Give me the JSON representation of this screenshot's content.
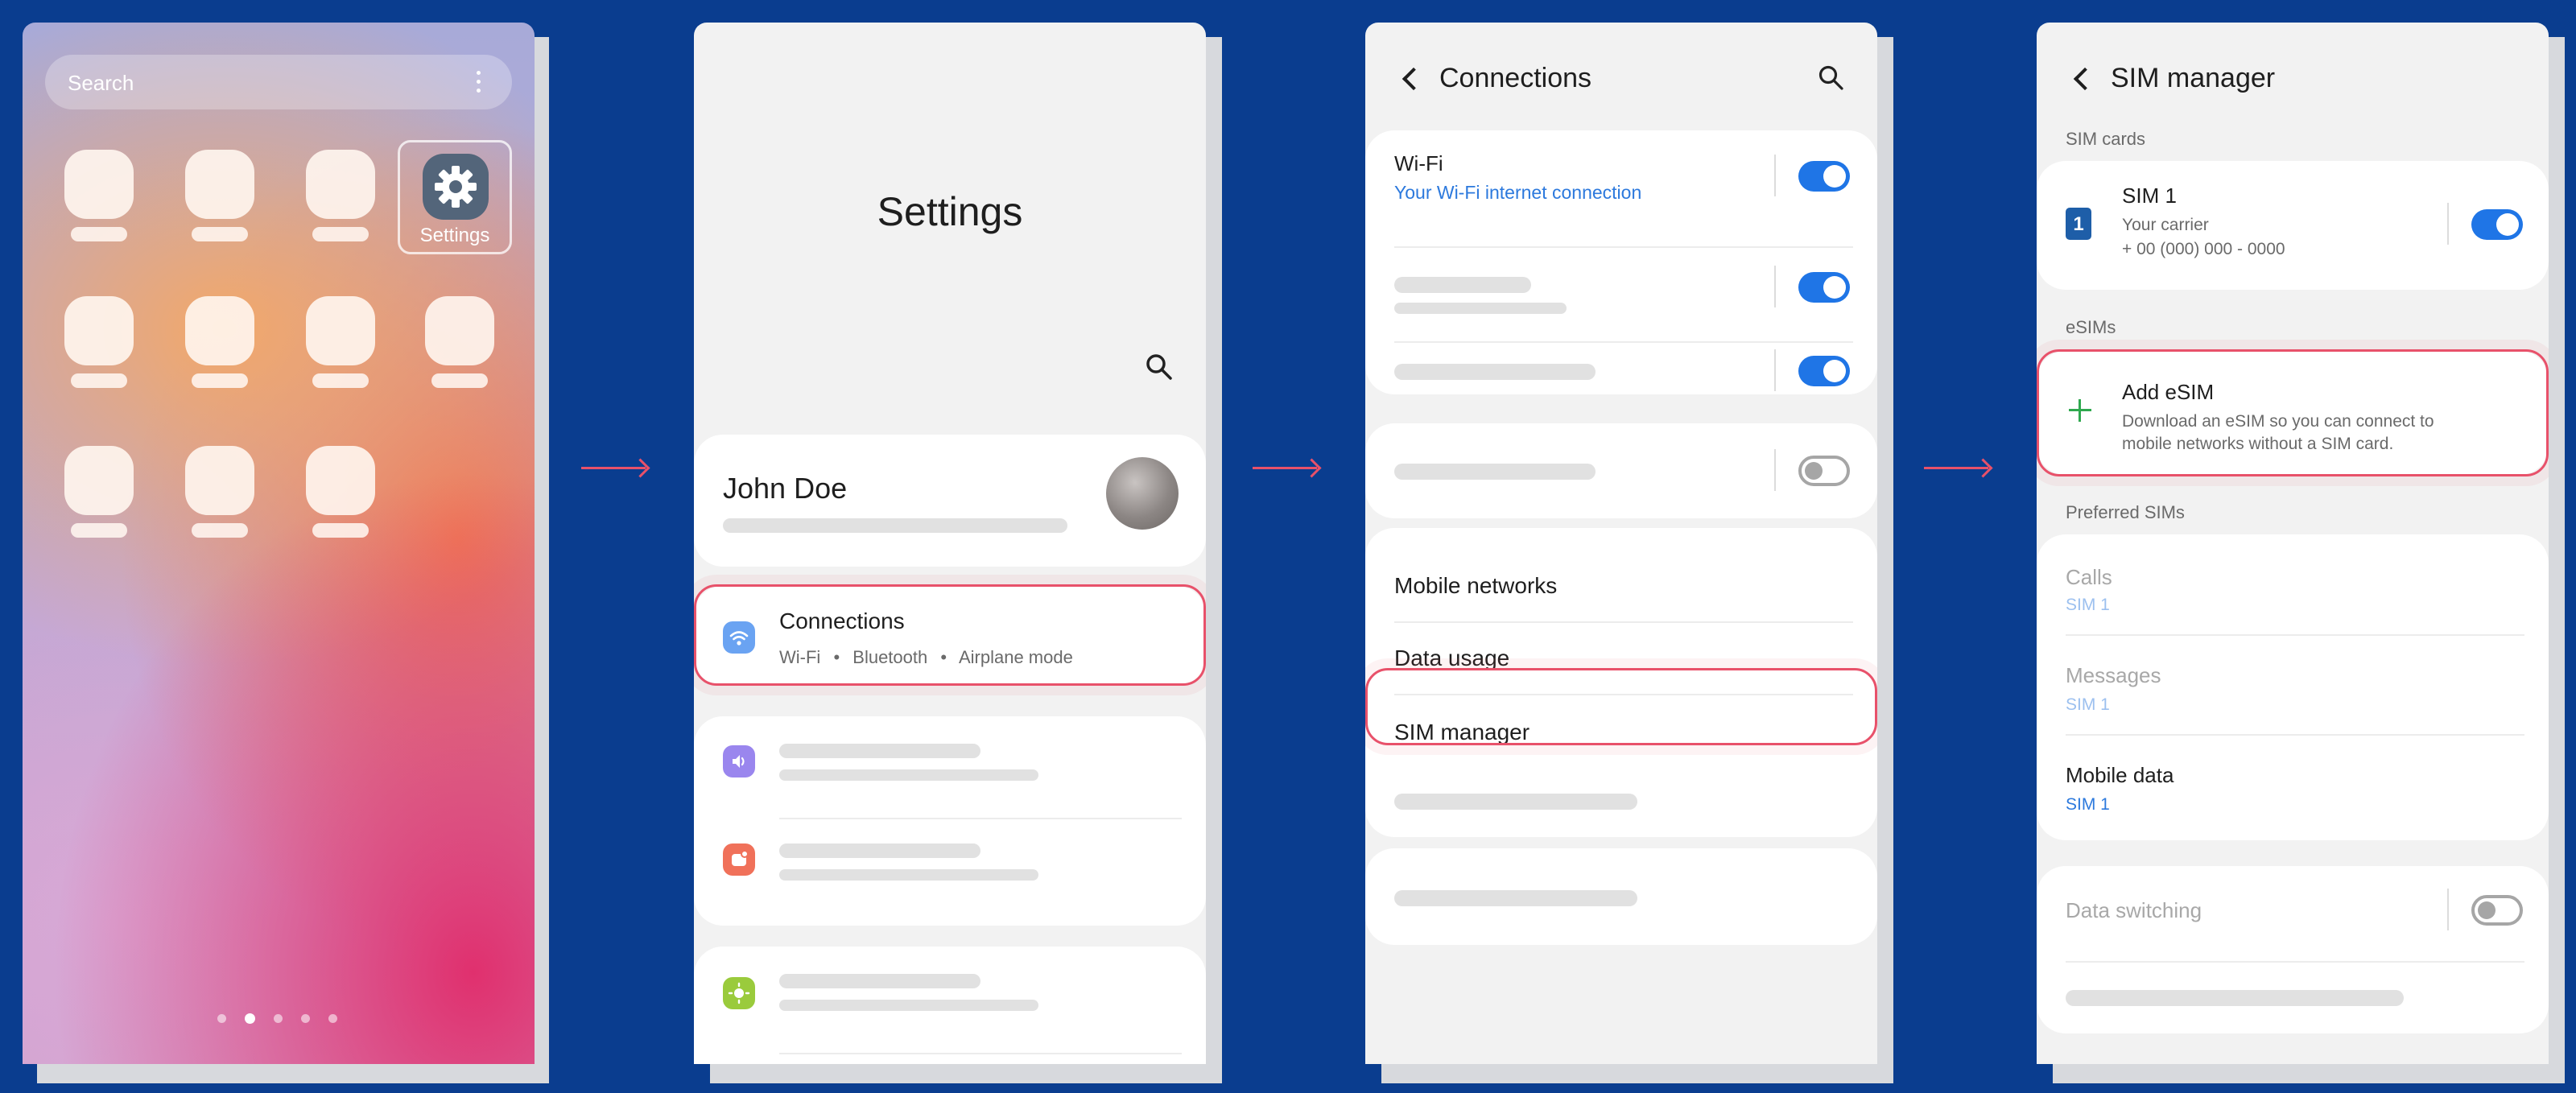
{
  "colors": {
    "background": "#0a3d8f",
    "highlight": "#e8516a",
    "accent_blue": "#1f75e6",
    "link_blue": "#2c79dd"
  },
  "home": {
    "search_placeholder": "Search",
    "settings_app_label": "Settings",
    "page_indicator_active": 2,
    "page_indicator_count": 5
  },
  "settings": {
    "title": "Settings",
    "profile_name": "John Doe",
    "connections_title": "Connections",
    "connections_sub_items": [
      "Wi-Fi",
      "Bluetooth",
      "Airplane mode"
    ],
    "connections_sub_separator": "•"
  },
  "connections": {
    "title": "Connections",
    "wifi_label": "Wi-Fi",
    "wifi_status": "Your Wi-Fi internet connection",
    "mobile_networks": "Mobile networks",
    "data_usage": "Data usage",
    "sim_manager": "SIM manager"
  },
  "sim_manager": {
    "title": "SIM manager",
    "sim_cards_header": "SIM cards",
    "sim1_badge": "1",
    "sim1_name": "SIM 1",
    "sim1_carrier": "Your carrier",
    "sim1_number": "+ 00 (000) 000 - 0000",
    "esims_header": "eSIMs",
    "add_esim_title": "Add eSIM",
    "add_esim_line1": "Download an eSIM so you can connect to",
    "add_esim_line2": "mobile networks without a SIM card.",
    "preferred_header": "Preferred SIMs",
    "calls_label": "Calls",
    "calls_value": "SIM 1",
    "messages_label": "Messages",
    "messages_value": "SIM 1",
    "mobile_data_label": "Mobile data",
    "mobile_data_value": "SIM 1",
    "data_switching": "Data switching"
  }
}
